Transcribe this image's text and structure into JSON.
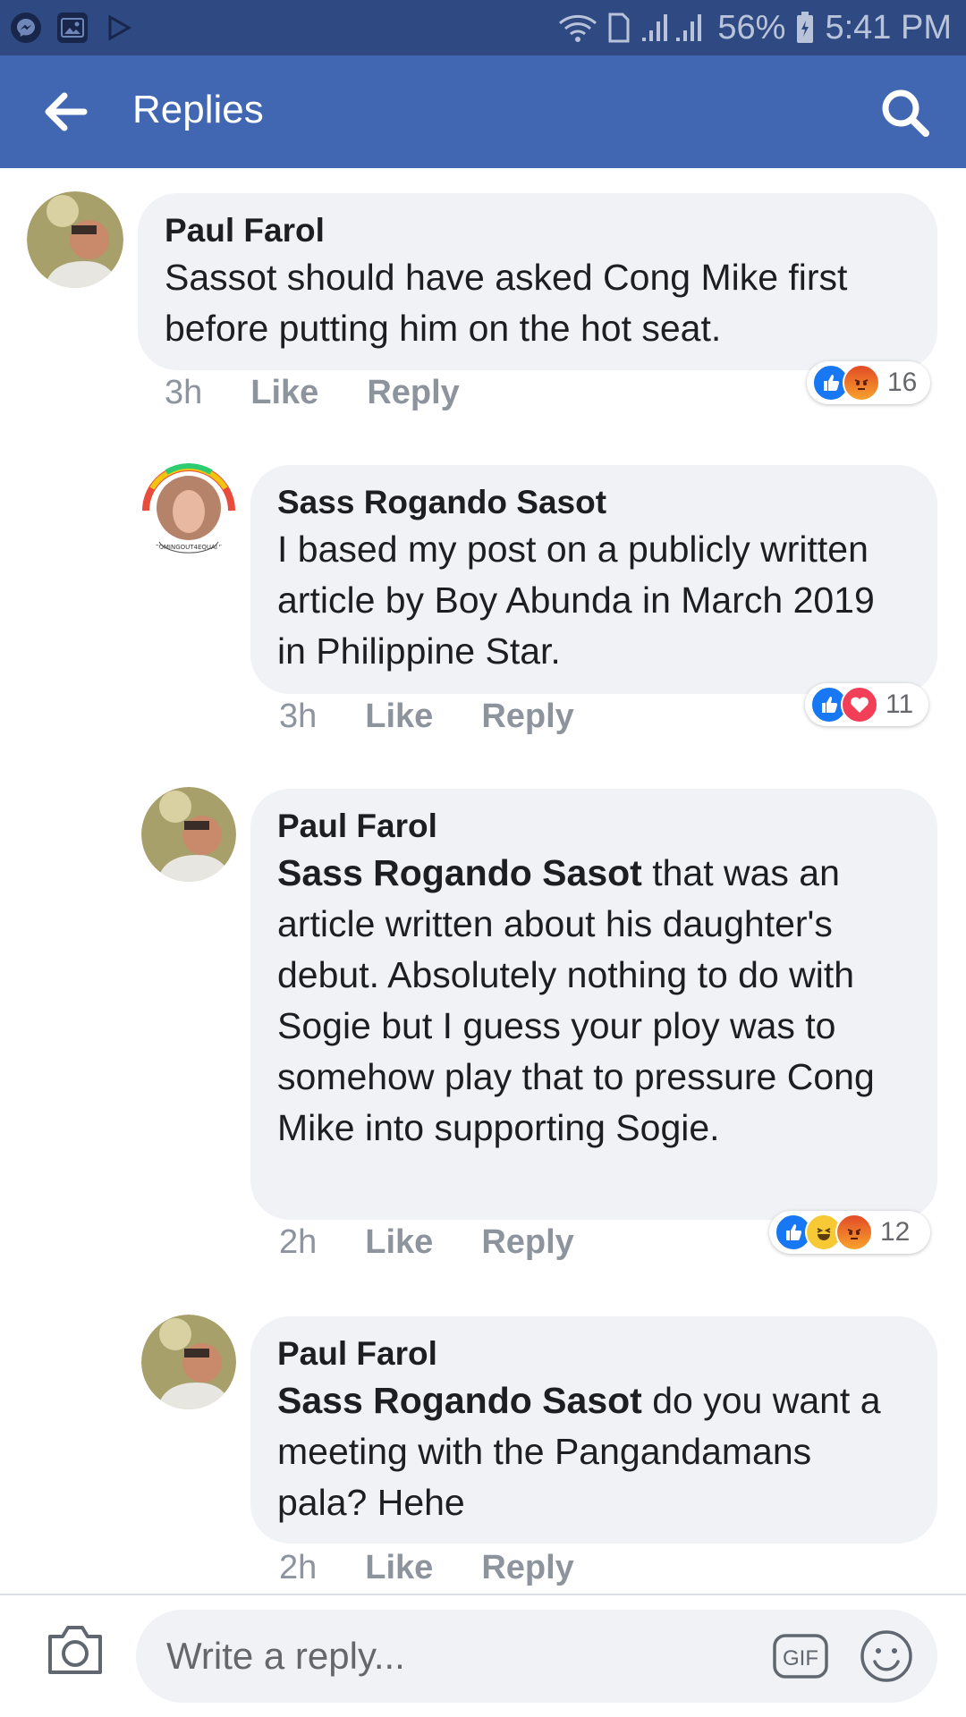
{
  "status_bar": {
    "battery": "56%",
    "time": "5:41 PM",
    "icons": [
      "messenger-icon",
      "gallery-icon",
      "play-store-icon",
      "wifi-icon",
      "sim-icon",
      "signal-icon",
      "battery-icon"
    ]
  },
  "app_bar": {
    "title": "Replies",
    "back_icon": "back-arrow-icon",
    "search_icon": "search-icon"
  },
  "comments": [
    {
      "author": "Paul Farol",
      "mention": "",
      "text": "Sassot should have asked Cong Mike first before putting him on the hot seat.",
      "time": "3h",
      "like_label": "Like",
      "reply_label": "Reply",
      "reactions": [
        "like",
        "angry"
      ],
      "reaction_count": "16"
    },
    {
      "author": "Sass Rogando Sasot",
      "mention": "",
      "text": "I based my post on a publicly written article by Boy Abunda in March 2019 in Philippine Star.",
      "time": "3h",
      "like_label": "Like",
      "reply_label": "Reply",
      "reactions": [
        "like",
        "love"
      ],
      "reaction_count": "11",
      "avatar_ring_text": "#COMINGOUT4EQUALITY"
    },
    {
      "author": "Paul Farol",
      "mention": "Sass Rogando Sasot",
      "text": " that was an article written about his daughter's debut. Absolutely nothing to do with Sogie but I guess your ploy was to somehow play that to pressure Cong Mike into supporting Sogie.",
      "time": "2h",
      "like_label": "Like",
      "reply_label": "Reply",
      "reactions": [
        "like",
        "haha",
        "angry"
      ],
      "reaction_count": "12"
    },
    {
      "author": "Paul Farol",
      "mention": "Sass Rogando Sasot",
      "text": " do you want a meeting with the Pangandamans pala? Hehe",
      "time": "2h",
      "like_label": "Like",
      "reply_label": "Reply",
      "reactions": [],
      "reaction_count": ""
    }
  ],
  "composer": {
    "placeholder": "Write a reply...",
    "gif_label": "GIF",
    "camera_icon": "camera-icon",
    "emoji_icon": "emoji-icon"
  },
  "colors": {
    "app_bar": "#4267b2",
    "status_bar": "#2f4a82",
    "bubble": "#f0f2f5",
    "like": "#1877f2",
    "love": "#f33e58",
    "angry": "#f26a1b",
    "haha": "#f7c935"
  }
}
